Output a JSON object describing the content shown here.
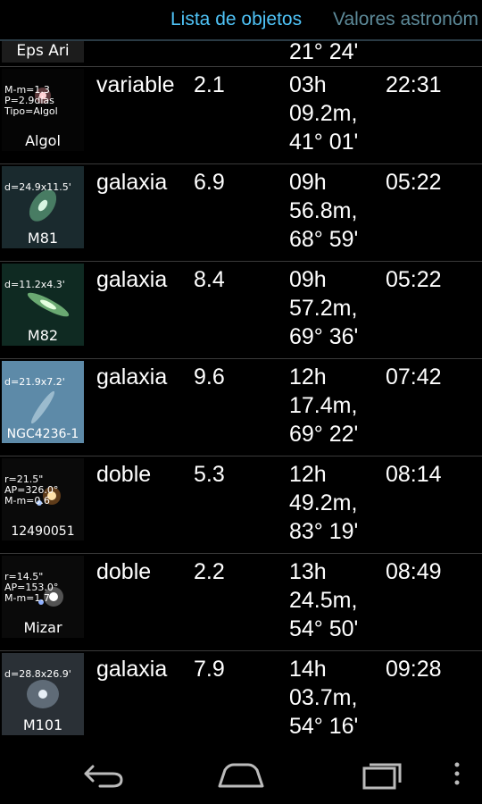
{
  "tabs": [
    {
      "label": "Lista de objetos",
      "active": true
    },
    {
      "label": "Valores astronóm",
      "active": false
    }
  ],
  "first_row": {
    "name": "Eps Ari",
    "coord_tail": "21° 24'"
  },
  "rows": [
    {
      "name": "Algol",
      "info": "M-m=1.3\nP=2.9días\nTipo=Algol",
      "type": "variable",
      "mag": "2.1",
      "coords": "03h\n09.2m,\n41° 01'",
      "time": "22:31"
    },
    {
      "name": "M81",
      "info": "d=24.9x11.5'",
      "type": "galaxia",
      "mag": "6.9",
      "coords": "09h\n56.8m,\n68° 59'",
      "time": "05:22"
    },
    {
      "name": "M82",
      "info": "d=11.2x4.3'",
      "type": "galaxia",
      "mag": "8.4",
      "coords": "09h\n57.2m,\n69° 36'",
      "time": "05:22"
    },
    {
      "name": "NGC4236-1",
      "info": "d=21.9x7.2'",
      "type": "galaxia",
      "mag": "9.6",
      "coords": "12h\n17.4m,\n69° 22'",
      "time": "07:42"
    },
    {
      "name": "12490051",
      "info": "r=21.5\"\nAP=326.0°\nM-m=0.6",
      "type": "doble",
      "mag": "5.3",
      "coords": "12h\n49.2m,\n83° 19'",
      "time": "08:14"
    },
    {
      "name": "Mizar",
      "info": "r=14.5\"\nAP=153.0°\nM-m=1.7",
      "type": "doble",
      "mag": "2.2",
      "coords": "13h\n24.5m,\n54° 50'",
      "time": "08:49"
    },
    {
      "name": "M101",
      "info": "d=28.8x26.9'",
      "type": "galaxia",
      "mag": "7.9",
      "coords": "14h\n03.7m,\n54° 16'",
      "time": "09:28"
    }
  ],
  "nav": {
    "back": "back-icon",
    "home": "home-icon",
    "recents": "recents-icon",
    "menu": "overflow-menu-icon"
  }
}
